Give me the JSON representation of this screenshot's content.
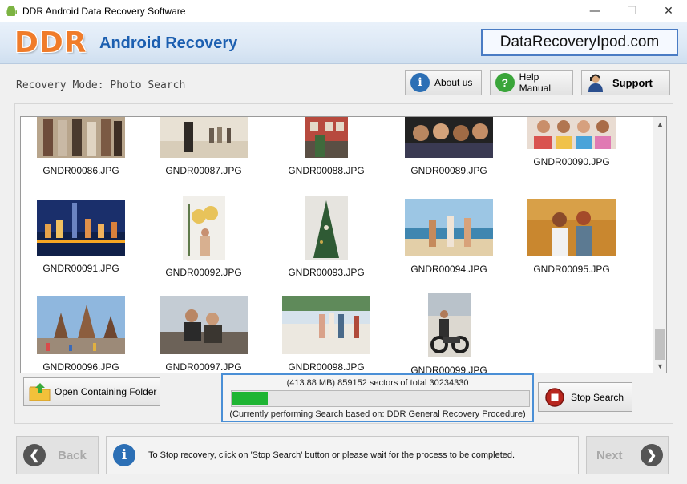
{
  "window": {
    "title": "DDR Android Data Recovery Software",
    "minimize": "—",
    "maximize": "☐",
    "close": "✕"
  },
  "header": {
    "logo": "DDR",
    "product": "Android Recovery",
    "website": "DataRecoveryIpod.com"
  },
  "toolbar": {
    "mode_label": "Recovery Mode: Photo Search",
    "about_label": "About us",
    "help_label": "Help Manual",
    "support_label": "Support"
  },
  "gallery": {
    "items": [
      {
        "name": "GNDR00086.JPG"
      },
      {
        "name": "GNDR00087.JPG"
      },
      {
        "name": "GNDR00088.JPG"
      },
      {
        "name": "GNDR00089.JPG"
      },
      {
        "name": "GNDR00090.JPG"
      },
      {
        "name": "GNDR00091.JPG"
      },
      {
        "name": "GNDR00092.JPG"
      },
      {
        "name": "GNDR00093.JPG"
      },
      {
        "name": "GNDR00094.JPG"
      },
      {
        "name": "GNDR00095.JPG"
      },
      {
        "name": "GNDR00096.JPG"
      },
      {
        "name": "GNDR00097.JPG"
      },
      {
        "name": "GNDR00098.JPG"
      },
      {
        "name": "GNDR00099.JPG"
      }
    ]
  },
  "actions": {
    "open_folder_label": "Open Containing Folder",
    "stop_search_label": "Stop Search"
  },
  "progress": {
    "status_line": "(413.88 MB) 859152  sectors  of  total 30234330",
    "fraction": 0.0284,
    "procedure_line": "(Currently performing Search based on:  DDR General Recovery Procedure)"
  },
  "footer": {
    "back_label": "Back",
    "next_label": "Next",
    "info_text": "To Stop recovery, click on 'Stop Search' button or please wait for the process to be completed."
  },
  "colors": {
    "logo_orange": "#f07c2a",
    "brand_blue": "#1c5fb0",
    "progress_green": "#1fb533",
    "focus_blue": "#4a8fd6"
  }
}
